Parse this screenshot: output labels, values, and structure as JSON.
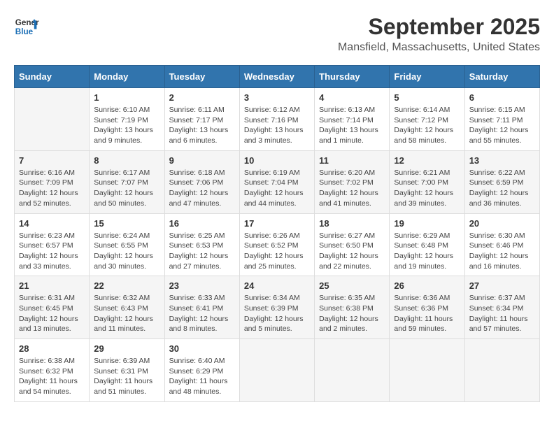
{
  "header": {
    "logo_line1": "General",
    "logo_line2": "Blue",
    "month": "September 2025",
    "location": "Mansfield, Massachusetts, United States"
  },
  "columns": [
    "Sunday",
    "Monday",
    "Tuesday",
    "Wednesday",
    "Thursday",
    "Friday",
    "Saturday"
  ],
  "weeks": [
    [
      {
        "day": "",
        "info": ""
      },
      {
        "day": "1",
        "info": "Sunrise: 6:10 AM\nSunset: 7:19 PM\nDaylight: 13 hours\nand 9 minutes."
      },
      {
        "day": "2",
        "info": "Sunrise: 6:11 AM\nSunset: 7:17 PM\nDaylight: 13 hours\nand 6 minutes."
      },
      {
        "day": "3",
        "info": "Sunrise: 6:12 AM\nSunset: 7:16 PM\nDaylight: 13 hours\nand 3 minutes."
      },
      {
        "day": "4",
        "info": "Sunrise: 6:13 AM\nSunset: 7:14 PM\nDaylight: 13 hours\nand 1 minute."
      },
      {
        "day": "5",
        "info": "Sunrise: 6:14 AM\nSunset: 7:12 PM\nDaylight: 12 hours\nand 58 minutes."
      },
      {
        "day": "6",
        "info": "Sunrise: 6:15 AM\nSunset: 7:11 PM\nDaylight: 12 hours\nand 55 minutes."
      }
    ],
    [
      {
        "day": "7",
        "info": "Sunrise: 6:16 AM\nSunset: 7:09 PM\nDaylight: 12 hours\nand 52 minutes."
      },
      {
        "day": "8",
        "info": "Sunrise: 6:17 AM\nSunset: 7:07 PM\nDaylight: 12 hours\nand 50 minutes."
      },
      {
        "day": "9",
        "info": "Sunrise: 6:18 AM\nSunset: 7:06 PM\nDaylight: 12 hours\nand 47 minutes."
      },
      {
        "day": "10",
        "info": "Sunrise: 6:19 AM\nSunset: 7:04 PM\nDaylight: 12 hours\nand 44 minutes."
      },
      {
        "day": "11",
        "info": "Sunrise: 6:20 AM\nSunset: 7:02 PM\nDaylight: 12 hours\nand 41 minutes."
      },
      {
        "day": "12",
        "info": "Sunrise: 6:21 AM\nSunset: 7:00 PM\nDaylight: 12 hours\nand 39 minutes."
      },
      {
        "day": "13",
        "info": "Sunrise: 6:22 AM\nSunset: 6:59 PM\nDaylight: 12 hours\nand 36 minutes."
      }
    ],
    [
      {
        "day": "14",
        "info": "Sunrise: 6:23 AM\nSunset: 6:57 PM\nDaylight: 12 hours\nand 33 minutes."
      },
      {
        "day": "15",
        "info": "Sunrise: 6:24 AM\nSunset: 6:55 PM\nDaylight: 12 hours\nand 30 minutes."
      },
      {
        "day": "16",
        "info": "Sunrise: 6:25 AM\nSunset: 6:53 PM\nDaylight: 12 hours\nand 27 minutes."
      },
      {
        "day": "17",
        "info": "Sunrise: 6:26 AM\nSunset: 6:52 PM\nDaylight: 12 hours\nand 25 minutes."
      },
      {
        "day": "18",
        "info": "Sunrise: 6:27 AM\nSunset: 6:50 PM\nDaylight: 12 hours\nand 22 minutes."
      },
      {
        "day": "19",
        "info": "Sunrise: 6:29 AM\nSunset: 6:48 PM\nDaylight: 12 hours\nand 19 minutes."
      },
      {
        "day": "20",
        "info": "Sunrise: 6:30 AM\nSunset: 6:46 PM\nDaylight: 12 hours\nand 16 minutes."
      }
    ],
    [
      {
        "day": "21",
        "info": "Sunrise: 6:31 AM\nSunset: 6:45 PM\nDaylight: 12 hours\nand 13 minutes."
      },
      {
        "day": "22",
        "info": "Sunrise: 6:32 AM\nSunset: 6:43 PM\nDaylight: 12 hours\nand 11 minutes."
      },
      {
        "day": "23",
        "info": "Sunrise: 6:33 AM\nSunset: 6:41 PM\nDaylight: 12 hours\nand 8 minutes."
      },
      {
        "day": "24",
        "info": "Sunrise: 6:34 AM\nSunset: 6:39 PM\nDaylight: 12 hours\nand 5 minutes."
      },
      {
        "day": "25",
        "info": "Sunrise: 6:35 AM\nSunset: 6:38 PM\nDaylight: 12 hours\nand 2 minutes."
      },
      {
        "day": "26",
        "info": "Sunrise: 6:36 AM\nSunset: 6:36 PM\nDaylight: 11 hours\nand 59 minutes."
      },
      {
        "day": "27",
        "info": "Sunrise: 6:37 AM\nSunset: 6:34 PM\nDaylight: 11 hours\nand 57 minutes."
      }
    ],
    [
      {
        "day": "28",
        "info": "Sunrise: 6:38 AM\nSunset: 6:32 PM\nDaylight: 11 hours\nand 54 minutes."
      },
      {
        "day": "29",
        "info": "Sunrise: 6:39 AM\nSunset: 6:31 PM\nDaylight: 11 hours\nand 51 minutes."
      },
      {
        "day": "30",
        "info": "Sunrise: 6:40 AM\nSunset: 6:29 PM\nDaylight: 11 hours\nand 48 minutes."
      },
      {
        "day": "",
        "info": ""
      },
      {
        "day": "",
        "info": ""
      },
      {
        "day": "",
        "info": ""
      },
      {
        "day": "",
        "info": ""
      }
    ]
  ]
}
